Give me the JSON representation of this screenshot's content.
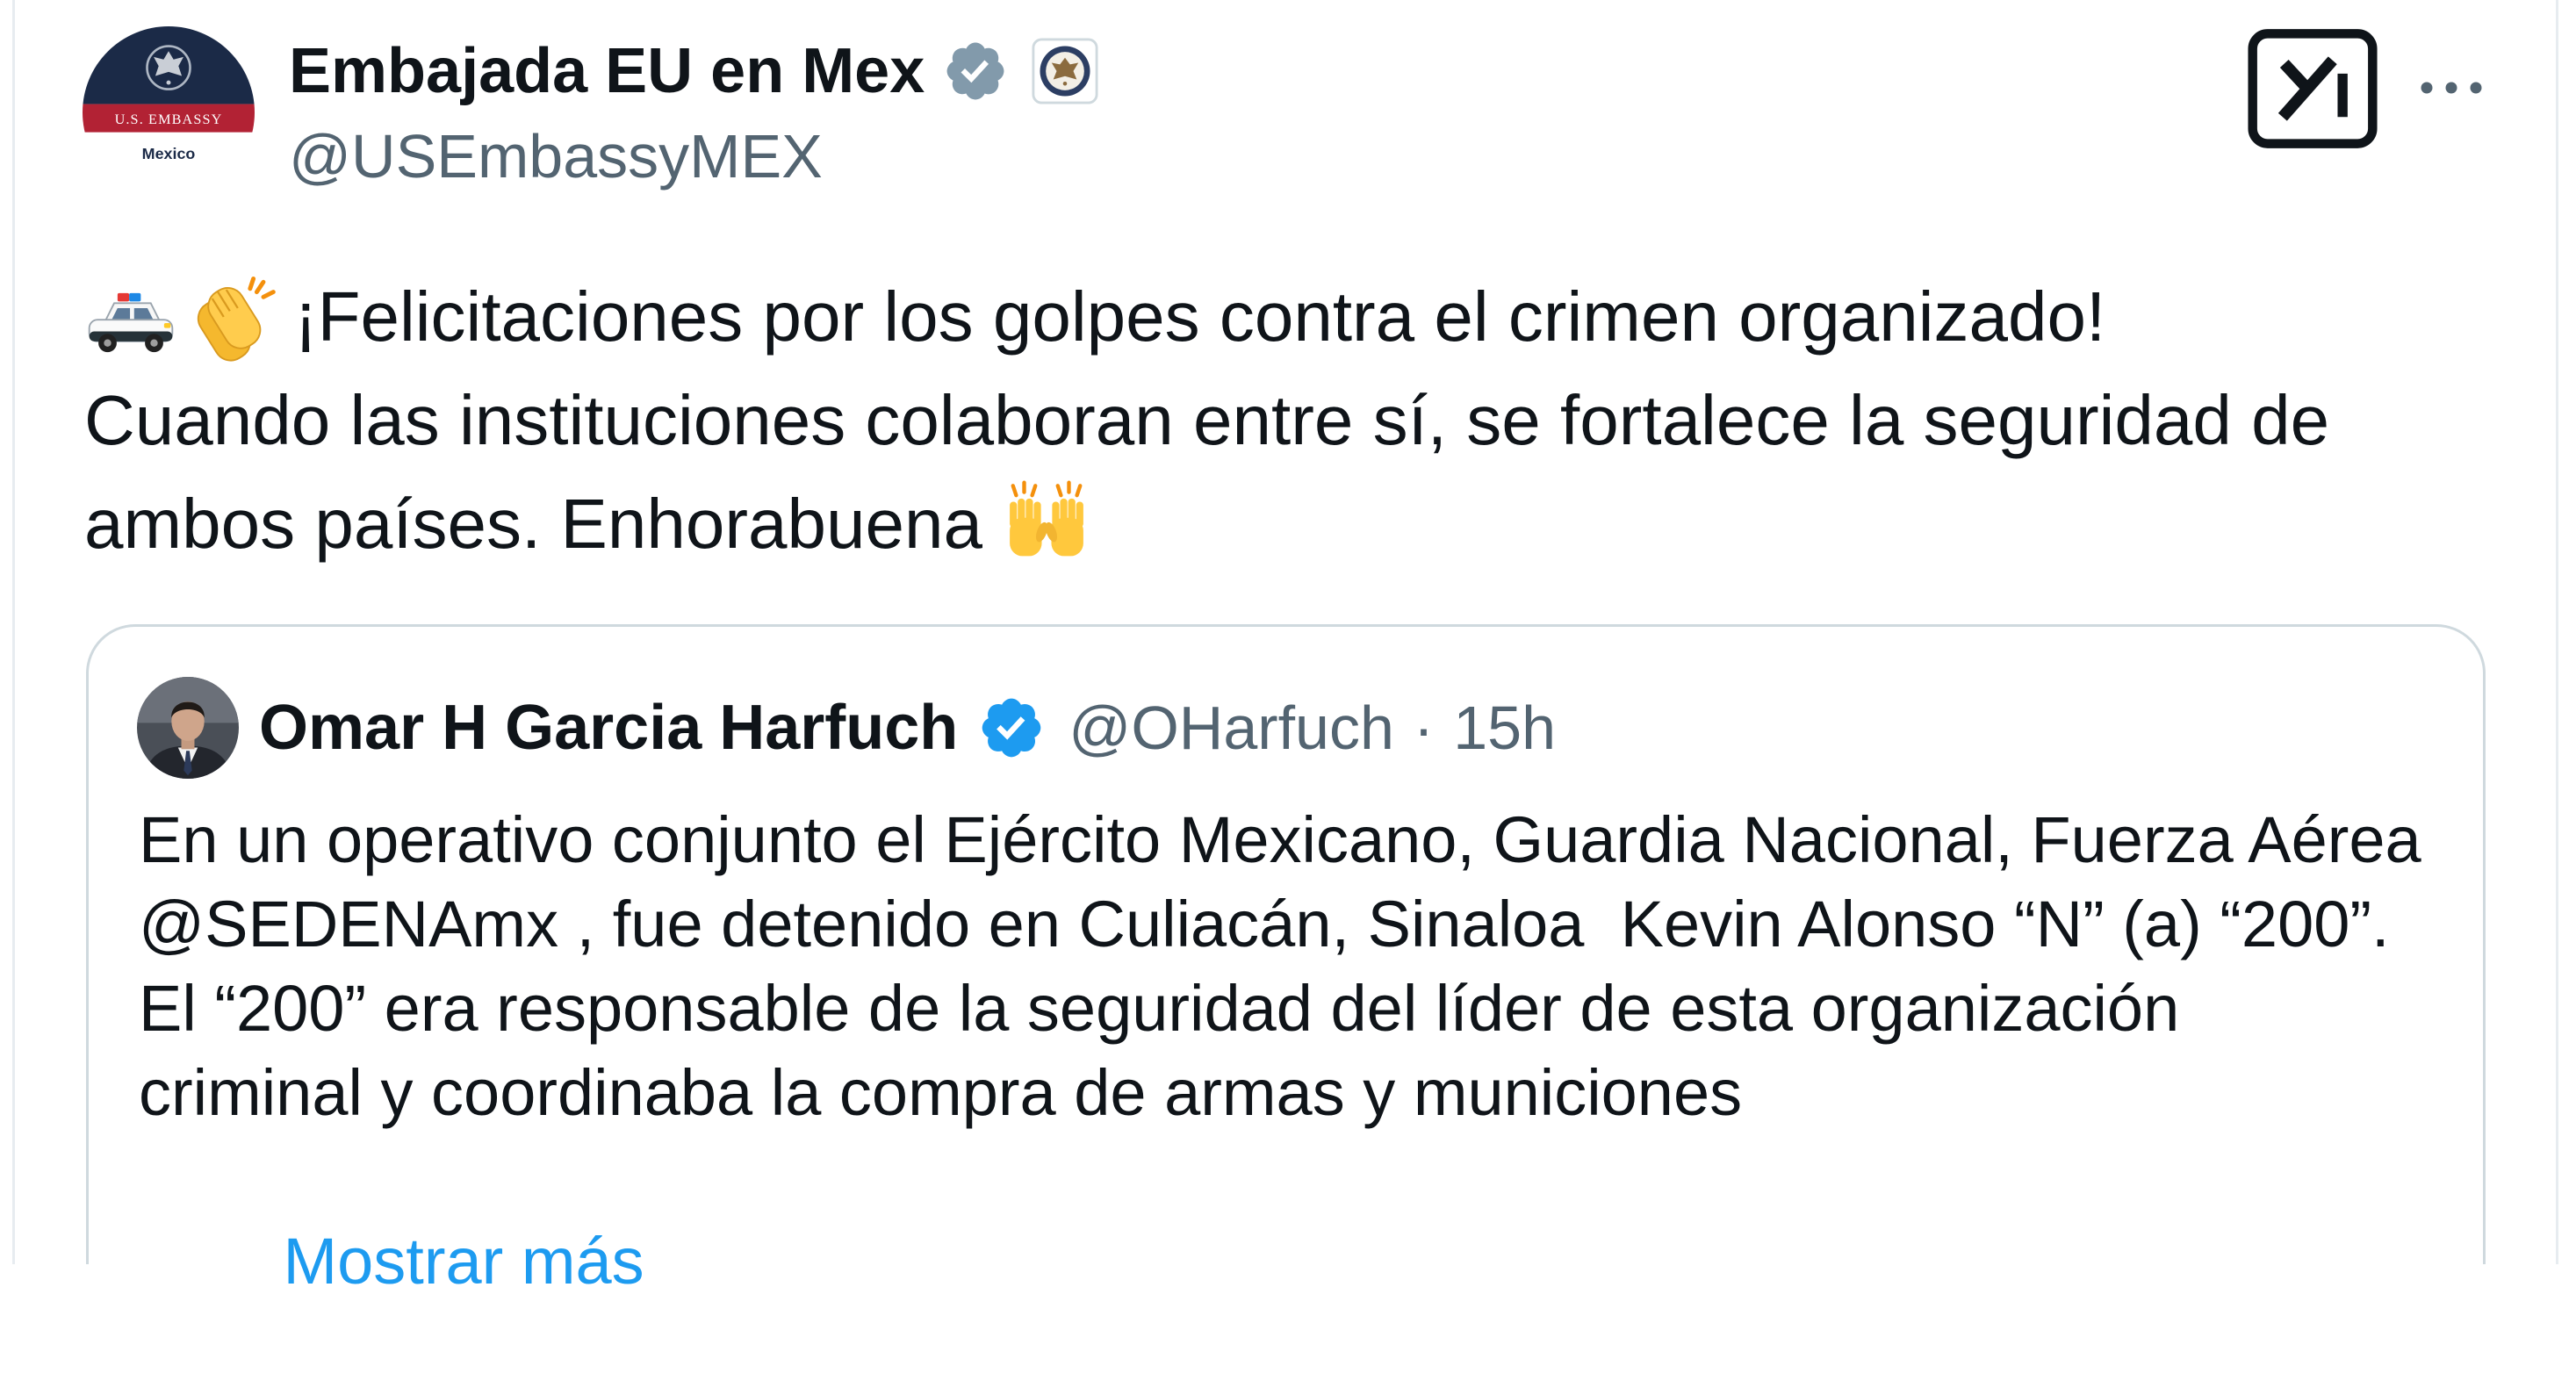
{
  "colors": {
    "text": "#0f1419",
    "secondary": "#536471",
    "link": "#1d9bf0",
    "border": "#cfd9de",
    "verified_gov": "#829aab",
    "verified_blue": "#1d9bf0"
  },
  "tweet": {
    "author": {
      "name": "Embajada EU en Mex",
      "handle": "@USEmbassyMEX",
      "verified_icon": "verified-badge-icon",
      "affiliation_icon": "us-department-of-state-seal-icon",
      "avatar_band_text": "U.S. EMBASSY",
      "avatar_caption": "Mexico"
    },
    "actions": {
      "grok_icon": "grok-icon",
      "more_icon": "more-icon"
    },
    "emoji_icons": [
      "police-car-icon",
      "clapping-hands-icon",
      "raised-hands-icon"
    ],
    "text_lines": [
      "¡Felicitaciones por los golpes contra el crimen organizado!",
      "Cuando las instituciones colaboran entre sí, se fortalece la seguridad de",
      "ambos países. Enhorabuena"
    ],
    "quote": {
      "author": {
        "name": "Omar H Garcia Harfuch",
        "handle": "@OHarfuch",
        "verified_icon": "verified-badge-icon"
      },
      "separator": "·",
      "time": "15h",
      "text_lines": [
        "En un operativo conjunto el Ejército Mexicano, Guardia Nacional, Fuerza Aérea",
        "@SEDENAmx , fue detenido en Culiacán, Sinaloa  Kevin Alonso “N” (a) “200”.",
        "El “200” era responsable de la seguridad del líder de esta organización",
        "criminal y coordinaba la compra de armas y municiones"
      ],
      "show_more_label": "Mostrar más"
    }
  }
}
